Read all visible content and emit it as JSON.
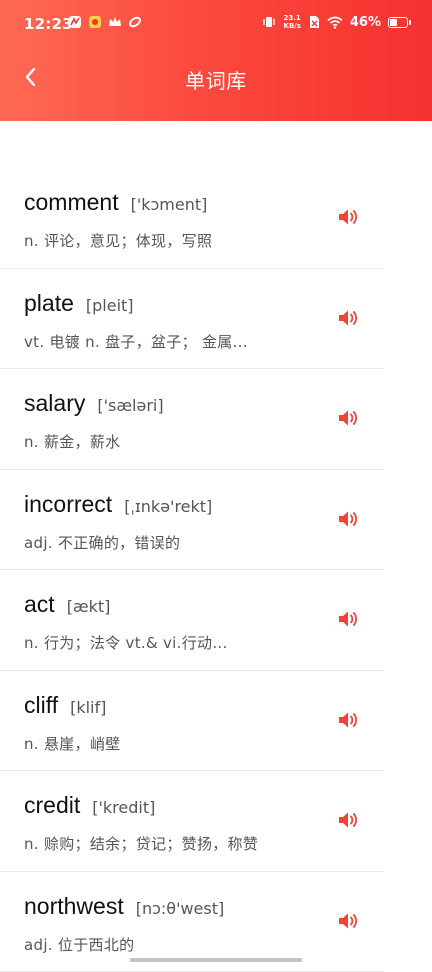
{
  "status_bar": {
    "time": "12:23",
    "net_speed_value": "23.1",
    "net_speed_unit": "KB/s",
    "battery_pct": "46%",
    "battery_level": 0.46
  },
  "header": {
    "title": "单词库",
    "back_icon": "chevron-left-icon"
  },
  "colors": {
    "header_gradient_start": "#ff6a55",
    "header_gradient_end": "#f5312f",
    "speaker_icon": "#f0443a"
  },
  "words": [
    {
      "word": "comment",
      "phonetic": "['kɔment]",
      "meaning": "n. 评论，意见；体现，写照",
      "icon": "speaker-icon"
    },
    {
      "word": "plate",
      "phonetic": "[pleit]",
      "meaning": "vt. 电镀  n. 盘子，盆子；  金属...",
      "icon": "speaker-icon"
    },
    {
      "word": "salary",
      "phonetic": "['sæləri]",
      "meaning": "n. 薪金，薪水",
      "icon": "speaker-icon"
    },
    {
      "word": "incorrect",
      "phonetic": "[ˌɪnkə'rekt]",
      "meaning": "adj. 不正确的，错误的",
      "icon": "speaker-icon"
    },
    {
      "word": "act",
      "phonetic": "[ækt]",
      "meaning": "n. 行为；法令  vt.& vi.行动...",
      "icon": "speaker-icon"
    },
    {
      "word": "cliff",
      "phonetic": "[klif]",
      "meaning": "n. 悬崖，峭壁",
      "icon": "speaker-icon"
    },
    {
      "word": "credit",
      "phonetic": "['kredit]",
      "meaning": "n. 赊购；结余；贷记；赞扬，称赞",
      "icon": "speaker-icon"
    },
    {
      "word": "northwest",
      "phonetic": "[nɔ:θ'west]",
      "meaning": "adj. 位于西北的",
      "icon": "speaker-icon"
    }
  ]
}
